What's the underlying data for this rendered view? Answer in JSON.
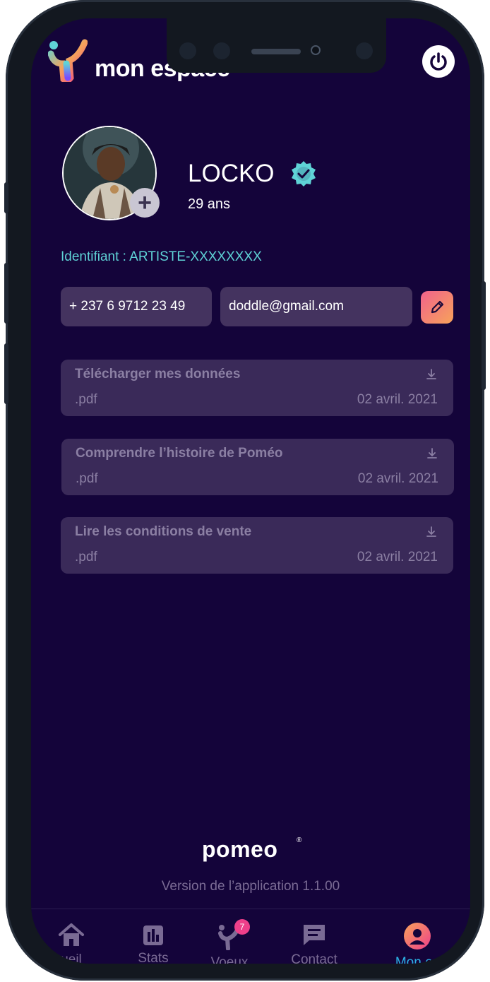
{
  "header": {
    "title": "mon espace"
  },
  "profile": {
    "name": "LOCKO",
    "age": "29 ans",
    "identifier": "Identifiant : ARTISTE-XXXXXXXX",
    "phone": "+ 237 6 9712 23 49",
    "email": "doddle@gmail.com"
  },
  "documents": [
    {
      "title": "Télécharger mes données",
      "ext": ".pdf",
      "date": "02 avril. 2021"
    },
    {
      "title": "Comprendre l’histoire de Poméo",
      "ext": ".pdf",
      "date": "02 avril. 2021"
    },
    {
      "title": "Lire les conditions de vente",
      "ext": ".pdf",
      "date": "02 avril. 2021"
    }
  ],
  "footer": {
    "brand": "pomeo",
    "registered": "®",
    "version": "Version de l’application 1.1.00"
  },
  "tabbar": {
    "tabs": [
      {
        "label": "ueil",
        "icon": "home-icon"
      },
      {
        "label": "Stats",
        "icon": "stats-icon"
      },
      {
        "label": "Voeux",
        "icon": "pomeo-icon",
        "badge": "7"
      },
      {
        "label": "Contact",
        "icon": "chat-icon"
      },
      {
        "label": "Mon es",
        "icon": "profile-icon",
        "active": true
      }
    ]
  },
  "colors": {
    "background": "#14043a",
    "accent_teal": "#5fd3d6",
    "accent_pink": "#ee3f8a",
    "active_tab": "#2bb3e6"
  }
}
